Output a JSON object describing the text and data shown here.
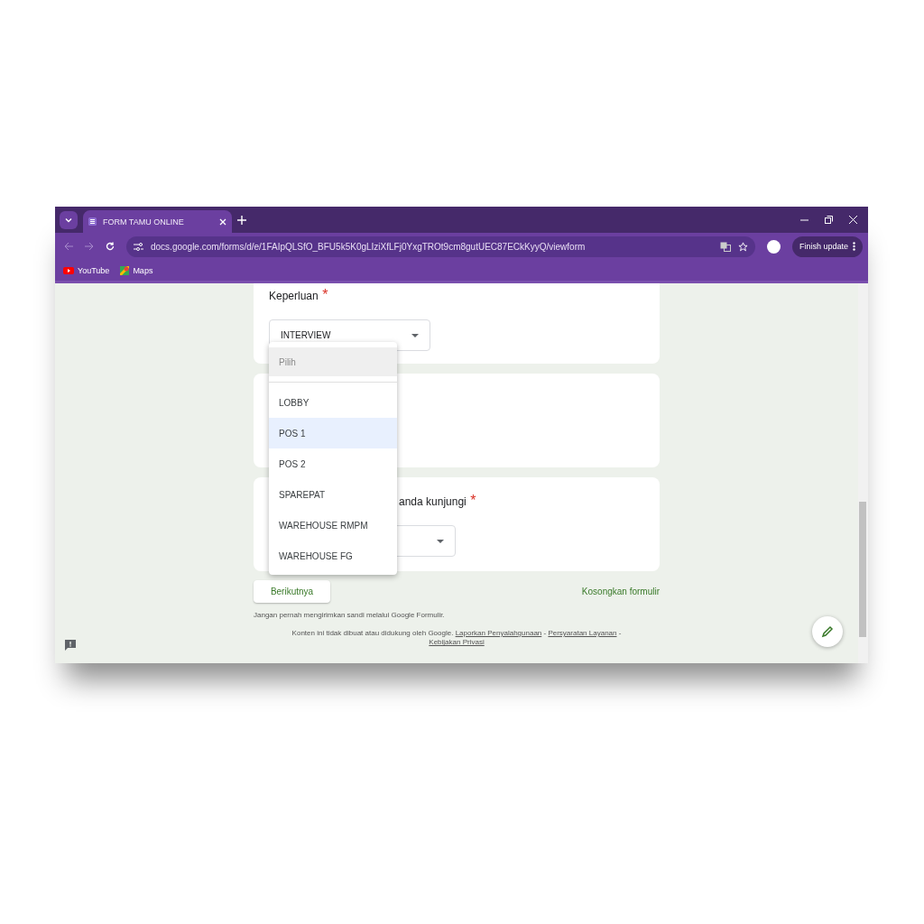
{
  "tab": {
    "title": "FORM TAMU ONLINE",
    "selected": true
  },
  "address": {
    "url": "docs.google.com/forms/d/e/1FAIpQLSfO_BFU5k5K0gLIziXfLFj0YxgTROt9cm8gutUEC87ECkKyyQ/viewform"
  },
  "update_button": "Finish update",
  "bookmarks": [
    {
      "label": "YouTube",
      "kind": "youtube"
    },
    {
      "label": "Maps",
      "kind": "maps"
    }
  ],
  "questions": [
    {
      "title": "Keperluan",
      "required_mark": "*",
      "value": "INTERVIEW"
    },
    {
      "title": "anda kunjungi",
      "required_mark": "*"
    }
  ],
  "dropdown": {
    "options": [
      {
        "label": "Pilih",
        "kind": "placeholder",
        "selected": false
      },
      {
        "label": "LOBBY",
        "kind": "option",
        "selected": false
      },
      {
        "label": "POS 1",
        "kind": "option",
        "selected": true
      },
      {
        "label": "POS 2",
        "kind": "option",
        "selected": false
      },
      {
        "label": "SPAREPAT",
        "kind": "option",
        "selected": false
      },
      {
        "label": "WAREHOUSE RMPM",
        "kind": "option",
        "selected": false
      },
      {
        "label": "WAREHOUSE FG",
        "kind": "option",
        "selected": false
      }
    ]
  },
  "next_button": "Berikutnya",
  "clear_link": "Kosongkan formulir",
  "footer": {
    "warning": "Jangan pernah mengirimkan sandi melalui Google Formulir.",
    "disclaimer": "Konten ini tidak dibuat atau didukung oleh Google.",
    "links": [
      "Laporkan Penyalahgunaan",
      "Persyaratan Layanan",
      "Kebijakan Privasi"
    ],
    "separator": "-"
  }
}
